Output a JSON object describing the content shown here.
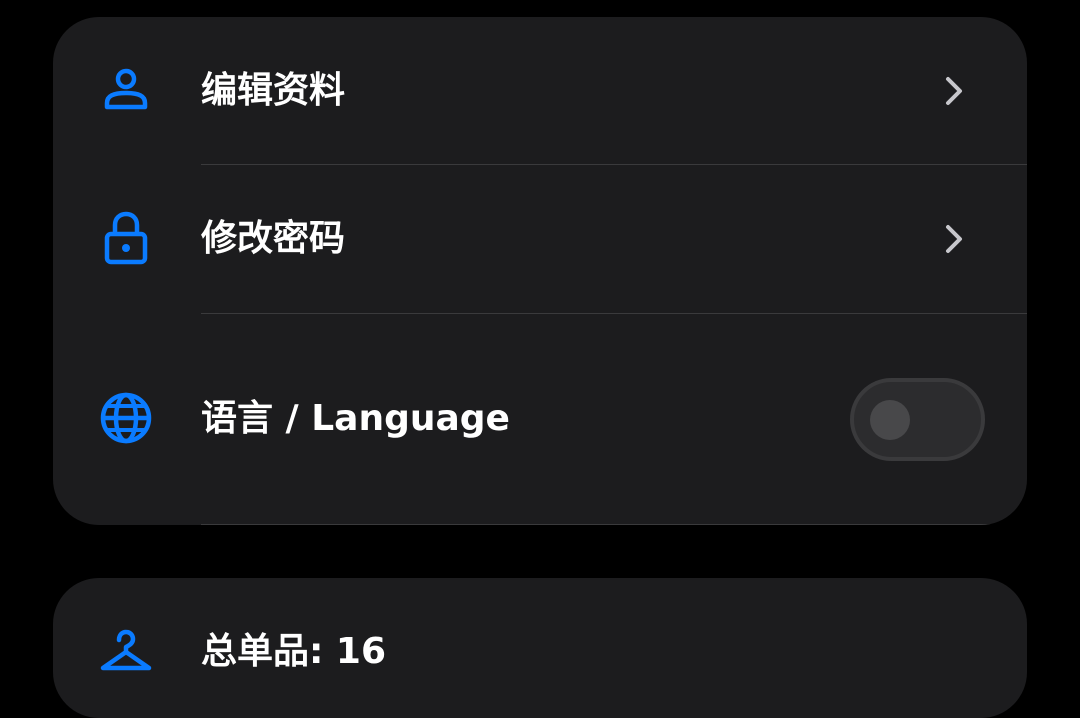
{
  "colors": {
    "accent": "#0a7bff",
    "card_bg": "#1c1c1e",
    "page_bg": "#000000"
  },
  "account": {
    "items": [
      {
        "label": "编辑资料",
        "icon": "person-icon"
      },
      {
        "label": "修改密码",
        "icon": "lock-icon"
      },
      {
        "label": "语言 / Language",
        "icon": "globe-icon",
        "toggle_on": false
      }
    ]
  },
  "stats": {
    "total_items_label": "总单品: 16",
    "icon": "hanger-icon"
  }
}
